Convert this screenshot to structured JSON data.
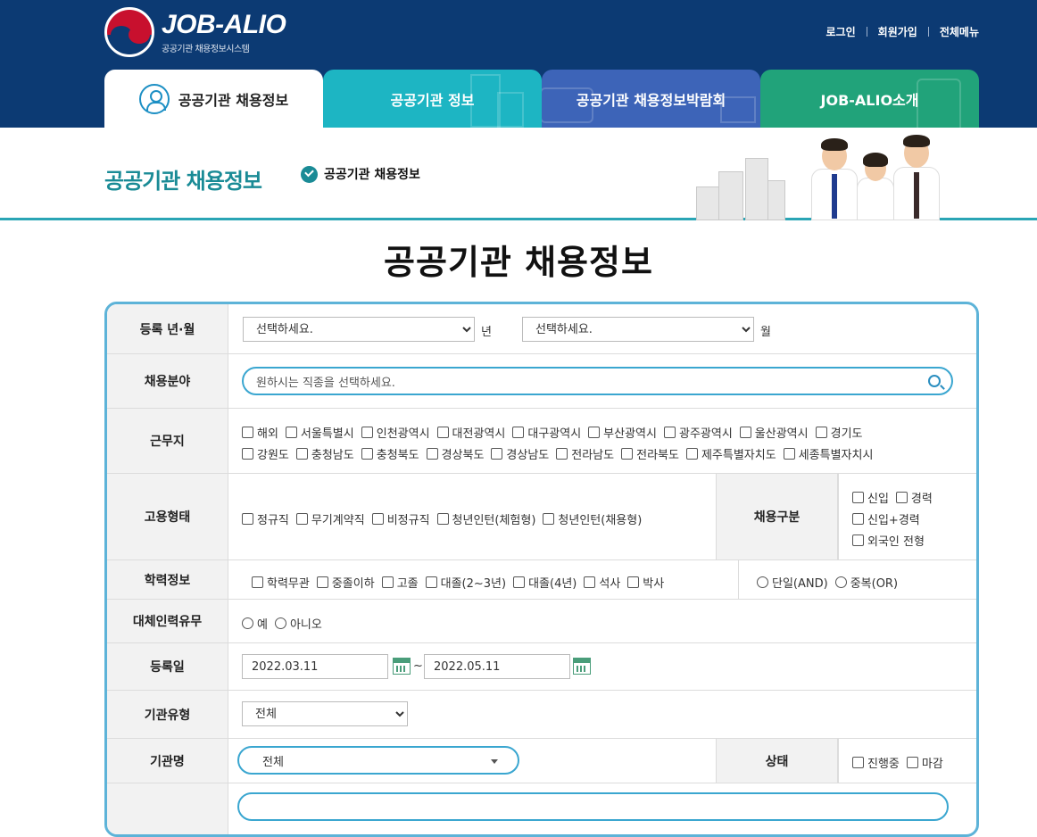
{
  "header": {
    "logo_title": "JOB-ALIO",
    "logo_subtitle": "공공기관 채용정보시스템",
    "util": {
      "login": "로그인",
      "signup": "회원가입",
      "menu": "전체메뉴"
    },
    "tabs": [
      {
        "label": "공공기관 채용정보",
        "active": true
      },
      {
        "label": "공공기관 정보"
      },
      {
        "label": "공공기관 채용정보박람회"
      },
      {
        "label": "JOB-ALIO소개"
      }
    ]
  },
  "subbar": {
    "title": "공공기관 채용정보",
    "breadcrumb": "공공기관 채용정보"
  },
  "page_title": "공공기관 채용정보",
  "form": {
    "reg_month": {
      "label": "등록 년·월",
      "year_value": "선택하세요.",
      "year_unit": "년",
      "month_value": "선택하세요.",
      "month_unit": "월"
    },
    "field": {
      "label": "채용분야",
      "placeholder": "원하시는 직종을 선택하세요."
    },
    "location": {
      "label": "근무지",
      "row1": [
        "해외",
        "서울특별시",
        "인천광역시",
        "대전광역시",
        "대구광역시",
        "부산광역시",
        "광주광역시",
        "울산광역시",
        "경기도"
      ],
      "row2": [
        "강원도",
        "충청남도",
        "충청북도",
        "경상북도",
        "경상남도",
        "전라남도",
        "전라북도",
        "제주특별자치도",
        "세종특별자치시"
      ]
    },
    "employment": {
      "label": "고용형태",
      "options": [
        "정규직",
        "무기계약직",
        "비정규직",
        "청년인턴(체험형)",
        "청년인턴(채용형)"
      ]
    },
    "hire_type": {
      "label": "채용구분",
      "options": [
        "신입",
        "경력",
        "신입+경력",
        "외국인 전형"
      ]
    },
    "education": {
      "label": "학력정보",
      "options": [
        "학력무관",
        "중졸이하",
        "고졸",
        "대졸(2~3년)",
        "대졸(4년)",
        "석사",
        "박사"
      ],
      "modes": [
        "단일(AND)",
        "중복(OR)"
      ]
    },
    "substitute": {
      "label": "대체인력유무",
      "options": [
        "예",
        "아니오"
      ]
    },
    "reg_date": {
      "label": "등록일",
      "from": "2022.03.11",
      "sep": "~",
      "to": "2022.05.11"
    },
    "org_type": {
      "label": "기관유형",
      "value": "전체"
    },
    "org_name": {
      "label": "기관명",
      "value": "전체"
    },
    "status": {
      "label": "상태",
      "options": [
        "진행중",
        "마감"
      ]
    }
  },
  "colors": {
    "header_bg": "#0c3a73",
    "tab2": "#1db5c3",
    "tab3": "#3d64b8",
    "tab4": "#21a37a",
    "accent": "#1a8b96",
    "form_border": "#5db3d8"
  }
}
